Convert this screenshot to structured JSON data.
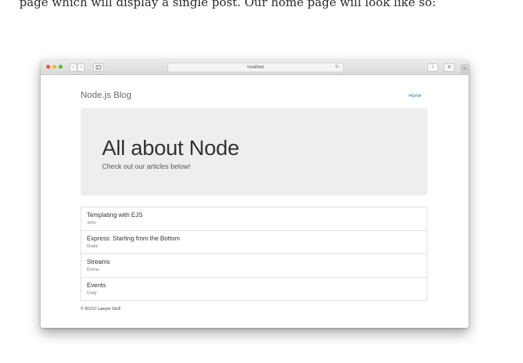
{
  "intro_text": "page which will display a single post. Our home page will look like so:",
  "browser": {
    "address": "localhost",
    "nav_back": "‹",
    "nav_forward": "›",
    "sidebar_icon": "sidebar-icon",
    "reload_icon": "↻",
    "share_icon": "⇧",
    "tabs_icon": "⧉",
    "newtab_icon": "+"
  },
  "site": {
    "brand": "Node.js Blog",
    "nav_home": "Home",
    "jumbotron": {
      "title": "All about Node",
      "subtitle": "Check out our articles below!"
    },
    "posts": [
      {
        "title": "Templating with EJS",
        "author": "John"
      },
      {
        "title": "Express: Starting from the Bottom",
        "author": "Drake"
      },
      {
        "title": "Streams",
        "author": "Emma"
      },
      {
        "title": "Events",
        "author": "Cody"
      }
    ],
    "footer": "© 90210 Lawyer Stuff."
  },
  "colors": {
    "link": "#337ab7",
    "jumbotron_bg": "#eeeeee",
    "traffic_red": "#ee5b52",
    "traffic_yellow": "#f5bd2f",
    "traffic_green": "#5fc03b"
  }
}
